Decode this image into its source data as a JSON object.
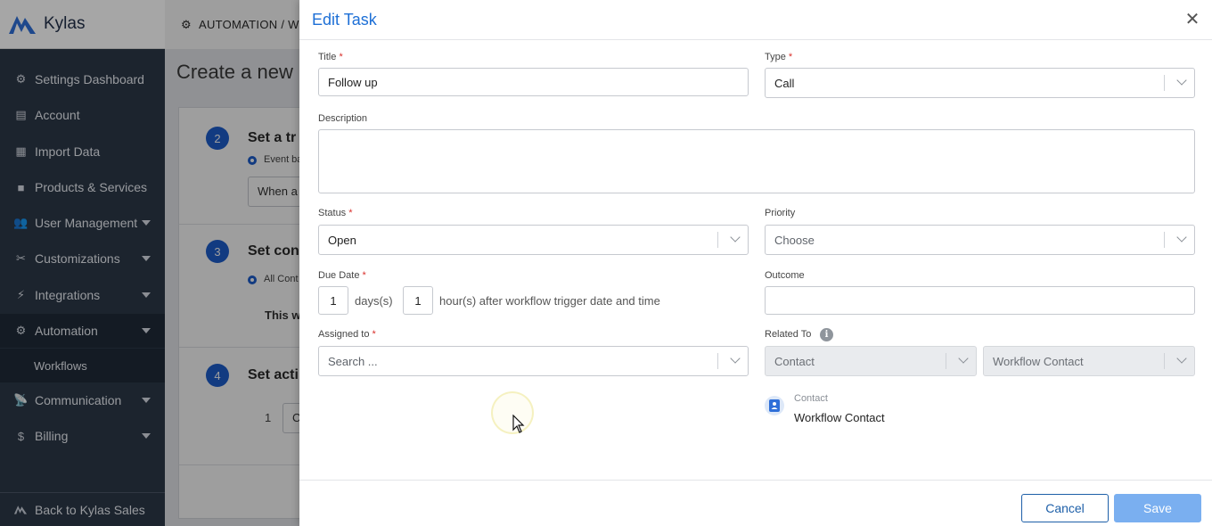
{
  "app": {
    "name": "Kylas",
    "brand_color": "#1d6fd6"
  },
  "sidebar": {
    "items": [
      {
        "label": "Settings Dashboard",
        "icon": "gear-icon",
        "has_caret": false
      },
      {
        "label": "Account",
        "icon": "id-card-icon",
        "has_caret": false
      },
      {
        "label": "Import Data",
        "icon": "table-icon",
        "has_caret": false
      },
      {
        "label": "Products & Services",
        "icon": "box-icon",
        "has_caret": false
      },
      {
        "label": "User Management",
        "icon": "users-icon",
        "has_caret": true
      },
      {
        "label": "Customizations",
        "icon": "tools-icon",
        "has_caret": true
      },
      {
        "label": "Integrations",
        "icon": "plug-icon",
        "has_caret": true
      },
      {
        "label": "Automation",
        "icon": "gears-icon",
        "has_caret": true,
        "active": true
      },
      {
        "label": "Communication",
        "icon": "satellite-icon",
        "has_caret": true
      },
      {
        "label": "Billing",
        "icon": "dollar-icon",
        "has_caret": true
      }
    ],
    "subitem": "Workflows",
    "footer": "Back to Kylas Sales"
  },
  "background": {
    "breadcrumb": "AUTOMATION / W",
    "page_title": "Create a new",
    "steps": [
      {
        "num": "2",
        "title": "Set a tr",
        "radio": "Event ba",
        "box": "When a"
      },
      {
        "num": "3",
        "title": "Set con",
        "radio": "All Cont",
        "text": "This w"
      },
      {
        "num": "4",
        "title": "Set acti",
        "row_num": "1",
        "box": "C"
      }
    ]
  },
  "modal": {
    "title": "Edit Task",
    "fields": {
      "title": {
        "label": "Title",
        "value": "Follow up"
      },
      "type": {
        "label": "Type",
        "value": "Call"
      },
      "description": {
        "label": "Description",
        "value": ""
      },
      "status": {
        "label": "Status",
        "value": "Open"
      },
      "priority": {
        "label": "Priority",
        "placeholder": "Choose"
      },
      "due_date": {
        "label": "Due Date",
        "days": "1",
        "days_label": "days(s)",
        "hours": "1",
        "hours_label": "hour(s) after workflow trigger date and time"
      },
      "outcome": {
        "label": "Outcome",
        "value": ""
      },
      "assigned_to": {
        "label": "Assigned to",
        "placeholder": "Search ..."
      },
      "related_to": {
        "label": "Related To",
        "entity": "Contact",
        "record": "Workflow Contact"
      }
    },
    "related_card": {
      "type_label": "Contact",
      "name": "Workflow Contact"
    },
    "buttons": {
      "cancel": "Cancel",
      "save": "Save"
    }
  }
}
